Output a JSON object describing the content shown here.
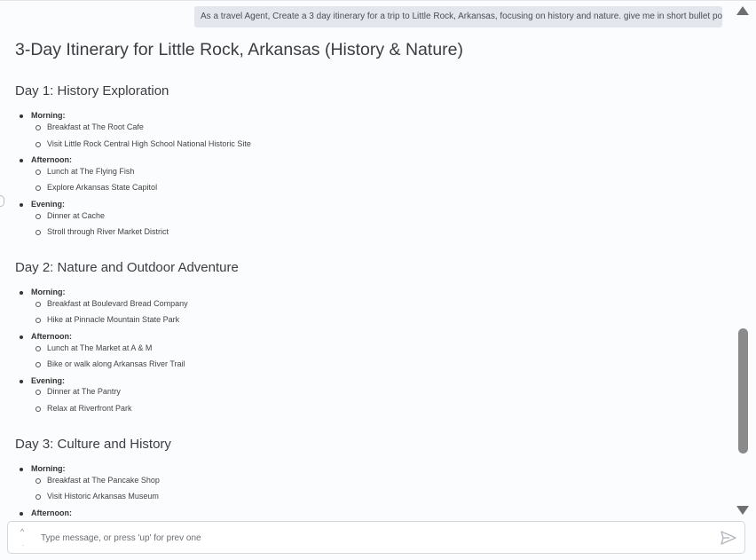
{
  "user_message": "As a travel Agent, Create a 3 day itinerary for a trip to Little Rock, Arkansas, focusing on history and nature. give me in short bullet points.",
  "response": {
    "title": "3-Day Itinerary for Little Rock, Arkansas (History & Nature)",
    "days": [
      {
        "title": "Day 1: History Exploration",
        "periods": [
          {
            "label": "Morning:",
            "items": [
              "Breakfast at The Root Cafe",
              "Visit Little Rock Central High School National Historic Site"
            ]
          },
          {
            "label": "Afternoon:",
            "items": [
              "Lunch at The Flying Fish",
              "Explore Arkansas State Capitol"
            ]
          },
          {
            "label": "Evening:",
            "items": [
              "Dinner at Cache",
              "Stroll through River Market District"
            ]
          }
        ]
      },
      {
        "title": "Day 2: Nature and Outdoor Adventure",
        "periods": [
          {
            "label": "Morning:",
            "items": [
              "Breakfast at Boulevard Bread Company",
              "Hike at Pinnacle Mountain State Park"
            ]
          },
          {
            "label": "Afternoon:",
            "items": [
              "Lunch at The Market at A & M",
              "Bike or walk along Arkansas River Trail"
            ]
          },
          {
            "label": "Evening:",
            "items": [
              "Dinner at The Pantry",
              "Relax at Riverfront Park"
            ]
          }
        ]
      },
      {
        "title": "Day 3: Culture and History",
        "periods": [
          {
            "label": "Morning:",
            "items": [
              "Breakfast at The Pancake Shop",
              "Visit Historic Arkansas Museum"
            ]
          },
          {
            "label": "Afternoon:",
            "items": []
          }
        ]
      }
    ]
  },
  "composer": {
    "placeholder": "Type message, or press 'up' for prev one",
    "history_up_glyph": "^",
    "history_dot_glyph": "."
  },
  "icons": {
    "send": "send-icon",
    "scroll_up": "triangle-up-icon",
    "scroll_down": "triangle-down-icon"
  },
  "colors": {
    "background": "#fbfcfd",
    "user_bubble": "#e3e6ec",
    "scrollbar": "#8a8a8a"
  }
}
